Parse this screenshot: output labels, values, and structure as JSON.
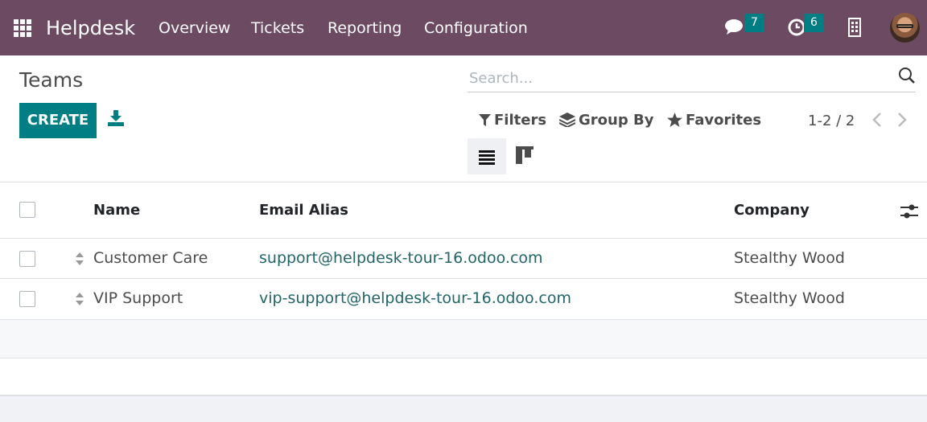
{
  "navbar": {
    "app_name": "Helpdesk",
    "menu": [
      "Overview",
      "Tickets",
      "Reporting",
      "Configuration"
    ],
    "messages_count": "7",
    "activities_count": "6",
    "icons": [
      "apps-icon",
      "chat-icon",
      "clock-icon",
      "building-icon",
      "user-avatar"
    ]
  },
  "control_panel": {
    "title": "Teams",
    "create_label": "CREATE",
    "search_placeholder": "Search...",
    "filters_label": "Filters",
    "group_by_label": "Group By",
    "favorites_label": "Favorites",
    "pager": "1-2 / 2"
  },
  "table": {
    "columns": [
      "Name",
      "Email Alias",
      "Company"
    ],
    "rows": [
      {
        "name": "Customer Care",
        "email": "support@helpdesk-tour-16.odoo.com",
        "company": "Stealthy Wood"
      },
      {
        "name": "VIP Support",
        "email": "vip-support@helpdesk-tour-16.odoo.com",
        "company": "Stealthy Wood"
      }
    ]
  },
  "colors": {
    "navbar": "#6b4a62",
    "primary": "#017e84",
    "link": "#226568"
  }
}
